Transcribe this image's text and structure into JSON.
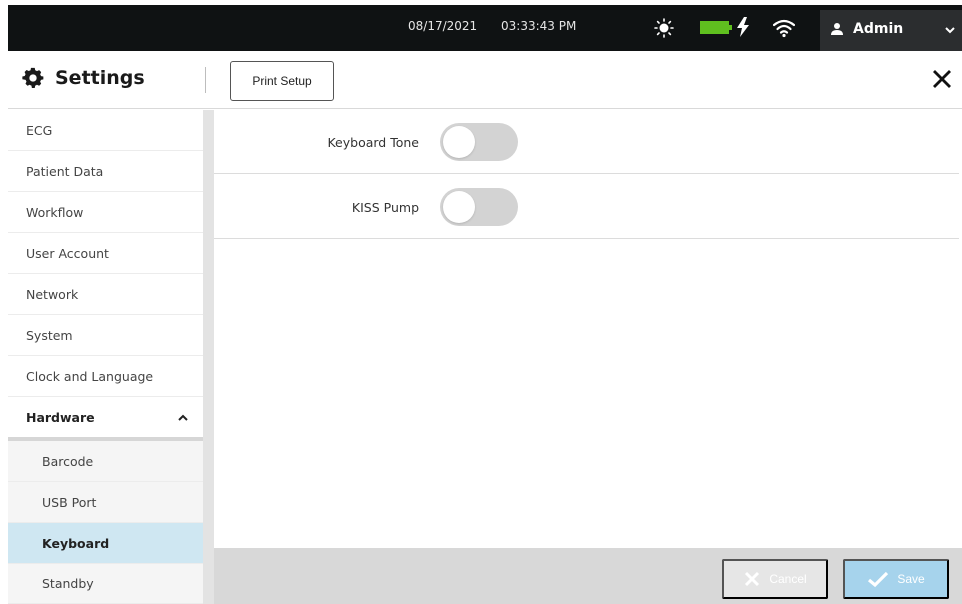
{
  "status_bar": {
    "date": "08/17/2021",
    "time": "03:33:43 PM",
    "battery_level_percent": 100,
    "user_label": "Admin"
  },
  "header": {
    "title": "Settings",
    "print_setup_label": "Print Setup"
  },
  "sidebar": {
    "items": [
      {
        "label": "ECG"
      },
      {
        "label": "Patient Data"
      },
      {
        "label": "Workflow"
      },
      {
        "label": "User Account"
      },
      {
        "label": "Network"
      },
      {
        "label": "System"
      },
      {
        "label": "Clock and Language"
      },
      {
        "label": "Hardware",
        "expanded": true
      },
      {
        "label": "Barcode"
      },
      {
        "label": "USB Port"
      },
      {
        "label": "Keyboard",
        "selected": true
      },
      {
        "label": "Standby"
      }
    ]
  },
  "main": {
    "settings": [
      {
        "label": "Keyboard Tone",
        "enabled": false
      },
      {
        "label": "KISS Pump",
        "enabled": false
      }
    ]
  },
  "footer": {
    "cancel_label": "Cancel",
    "save_label": "Save"
  },
  "colors": {
    "status_bar_bg": "#0f1213",
    "battery": "#5fbf1f",
    "selected_item_bg": "#cfe7f2",
    "save_button_bg": "#a6d3ec",
    "footer_bg": "#d8d8d8"
  }
}
